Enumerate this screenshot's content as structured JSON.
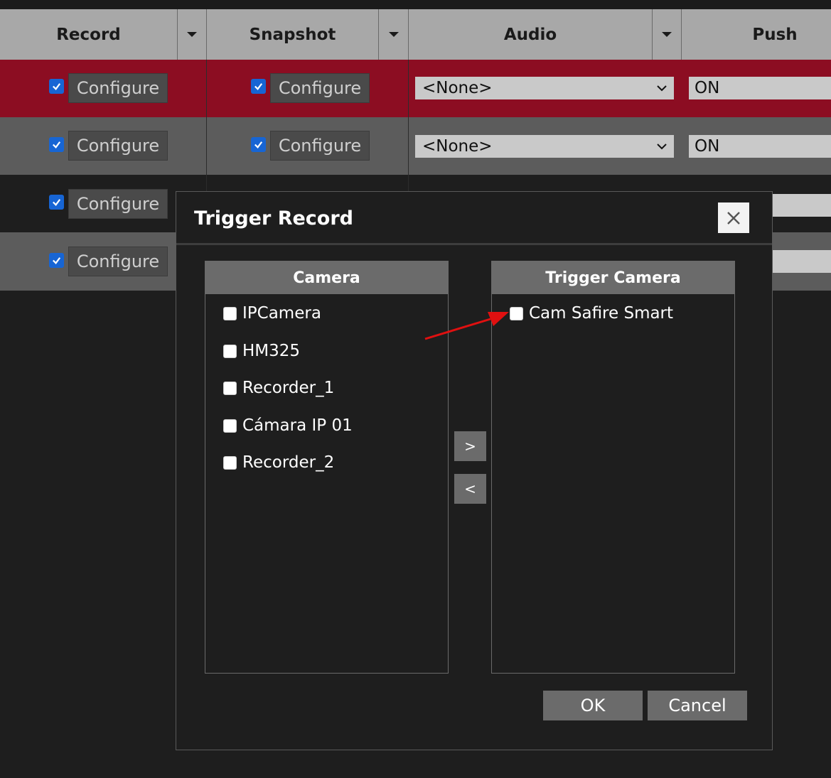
{
  "table": {
    "columns": {
      "record": "Record",
      "snapshot": "Snapshot",
      "audio": "Audio",
      "push": "Push"
    },
    "rows": [
      {
        "record_button": "Configure",
        "snapshot_button": "Configure",
        "audio": "<None>",
        "push": "ON",
        "record_checked": true,
        "snapshot_checked": true
      },
      {
        "record_button": "Configure",
        "snapshot_button": "Configure",
        "audio": "<None>",
        "push": "ON",
        "record_checked": true,
        "snapshot_checked": true
      },
      {
        "record_button": "Configure",
        "record_checked": true
      },
      {
        "record_button": "Configure",
        "record_checked": true
      }
    ]
  },
  "dialog": {
    "title": "Trigger Record",
    "camera_panel": {
      "header": "Camera",
      "items": [
        "IPCamera",
        "HM325",
        "Recorder_1",
        "Cámara IP 01",
        "Recorder_2"
      ]
    },
    "trigger_panel": {
      "header": "Trigger Camera",
      "items": [
        "Cam Safire Smart"
      ]
    },
    "move_right_label": ">",
    "move_left_label": "<",
    "ok_label": "OK",
    "cancel_label": "Cancel"
  },
  "colors": {
    "selected_row": "#8c0d22",
    "checkbox_accent": "#1765d4",
    "annotation_arrow": "#e01010"
  },
  "icons": {
    "close": "close-icon",
    "dropdown": "chevron-down-icon",
    "sort": "caret-down-icon"
  }
}
